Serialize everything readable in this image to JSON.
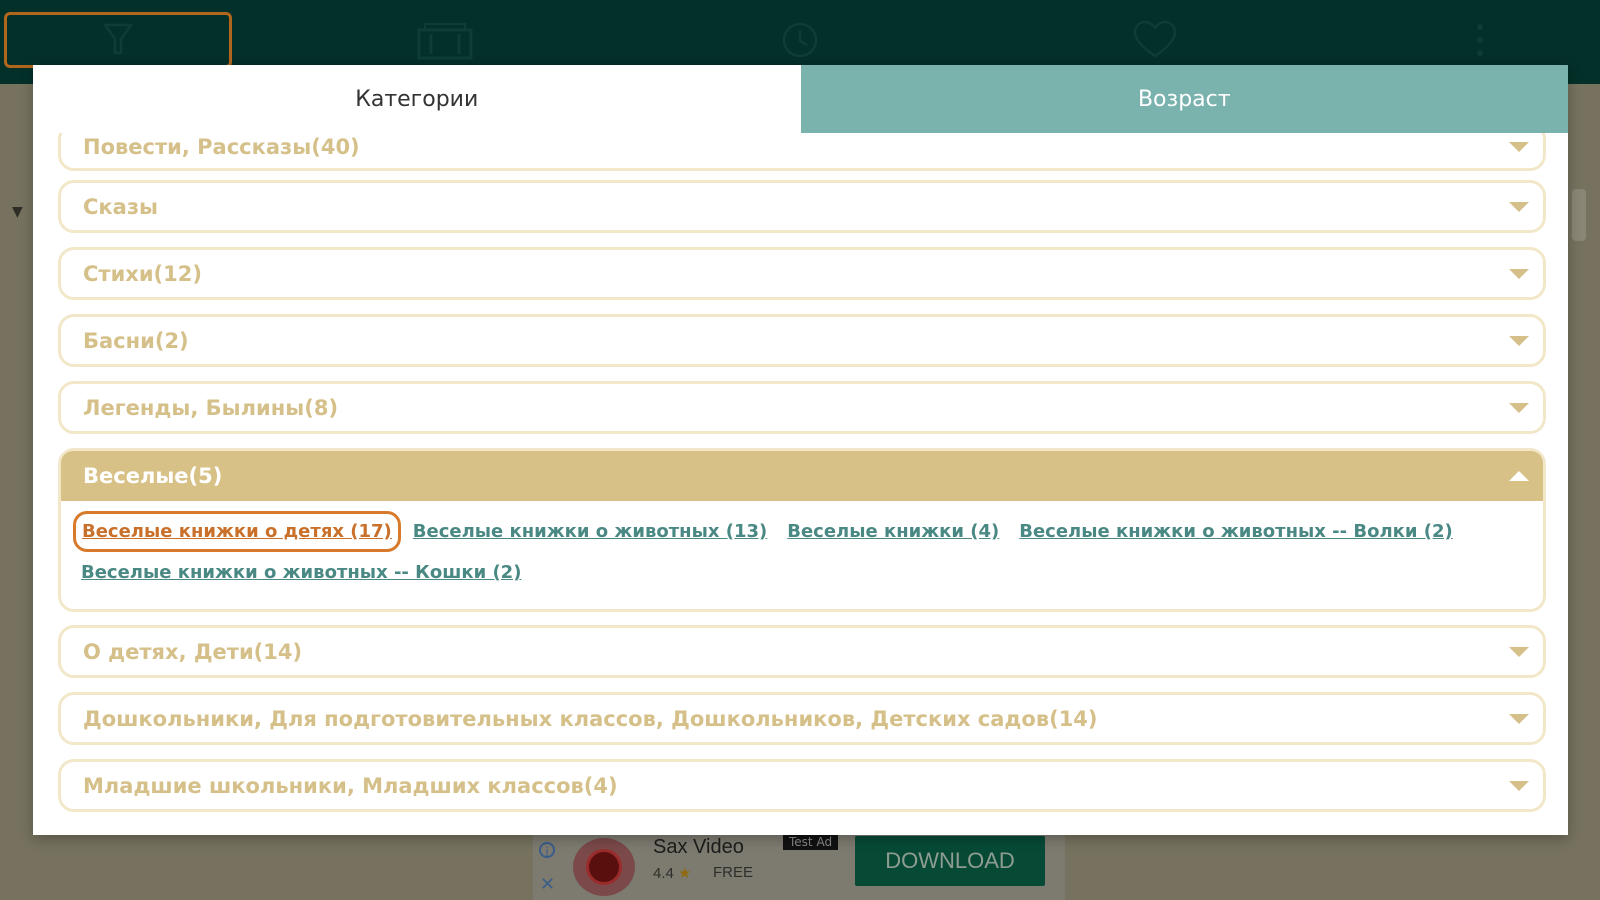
{
  "colors": {
    "topbar": "#033029",
    "tab_active": "#ffffff",
    "tab_inactive": "#7ab2ae",
    "accordion_border": "#f2e8c9",
    "accordion_text": "#d6c08a",
    "accordion_open_header": "#d8c187",
    "link": "#4a8884",
    "link_selected": "#c9702a"
  },
  "topbar": {
    "icons": [
      "filter-icon",
      "catalog-icon",
      "history-icon",
      "favorites-icon",
      "more-icon"
    ]
  },
  "dialog": {
    "tabs": {
      "categories": "Категории",
      "age": "Возраст"
    },
    "categories": [
      {
        "label": "Повести, Рассказы(40)"
      },
      {
        "label": "Сказы"
      },
      {
        "label": "Стихи(12)"
      },
      {
        "label": "Басни(2)"
      },
      {
        "label": "Легенды, Былины(8)"
      },
      {
        "label": "Веселые(5)",
        "expanded": true
      },
      {
        "label": "О детях, Дети(14)"
      },
      {
        "label": "Дошкольники, Для подготовительных классов, Дошкольников, Детских садов(14)"
      },
      {
        "label": "Младшие школьники, Младших классов(4)"
      }
    ],
    "subcategories": [
      "Веселые книжки о детях (17)",
      "Веселые книжки о животных (13)",
      "Веселые книжки (4)",
      "Веселые книжки о животных -- Волки (2)",
      "Веселые книжки о животных -- Кошки (2)"
    ]
  },
  "ad": {
    "title": "Sax Video",
    "tag": "Test Ad",
    "rating": "4.4",
    "price": "FREE",
    "download": "DOWNLOAD"
  }
}
